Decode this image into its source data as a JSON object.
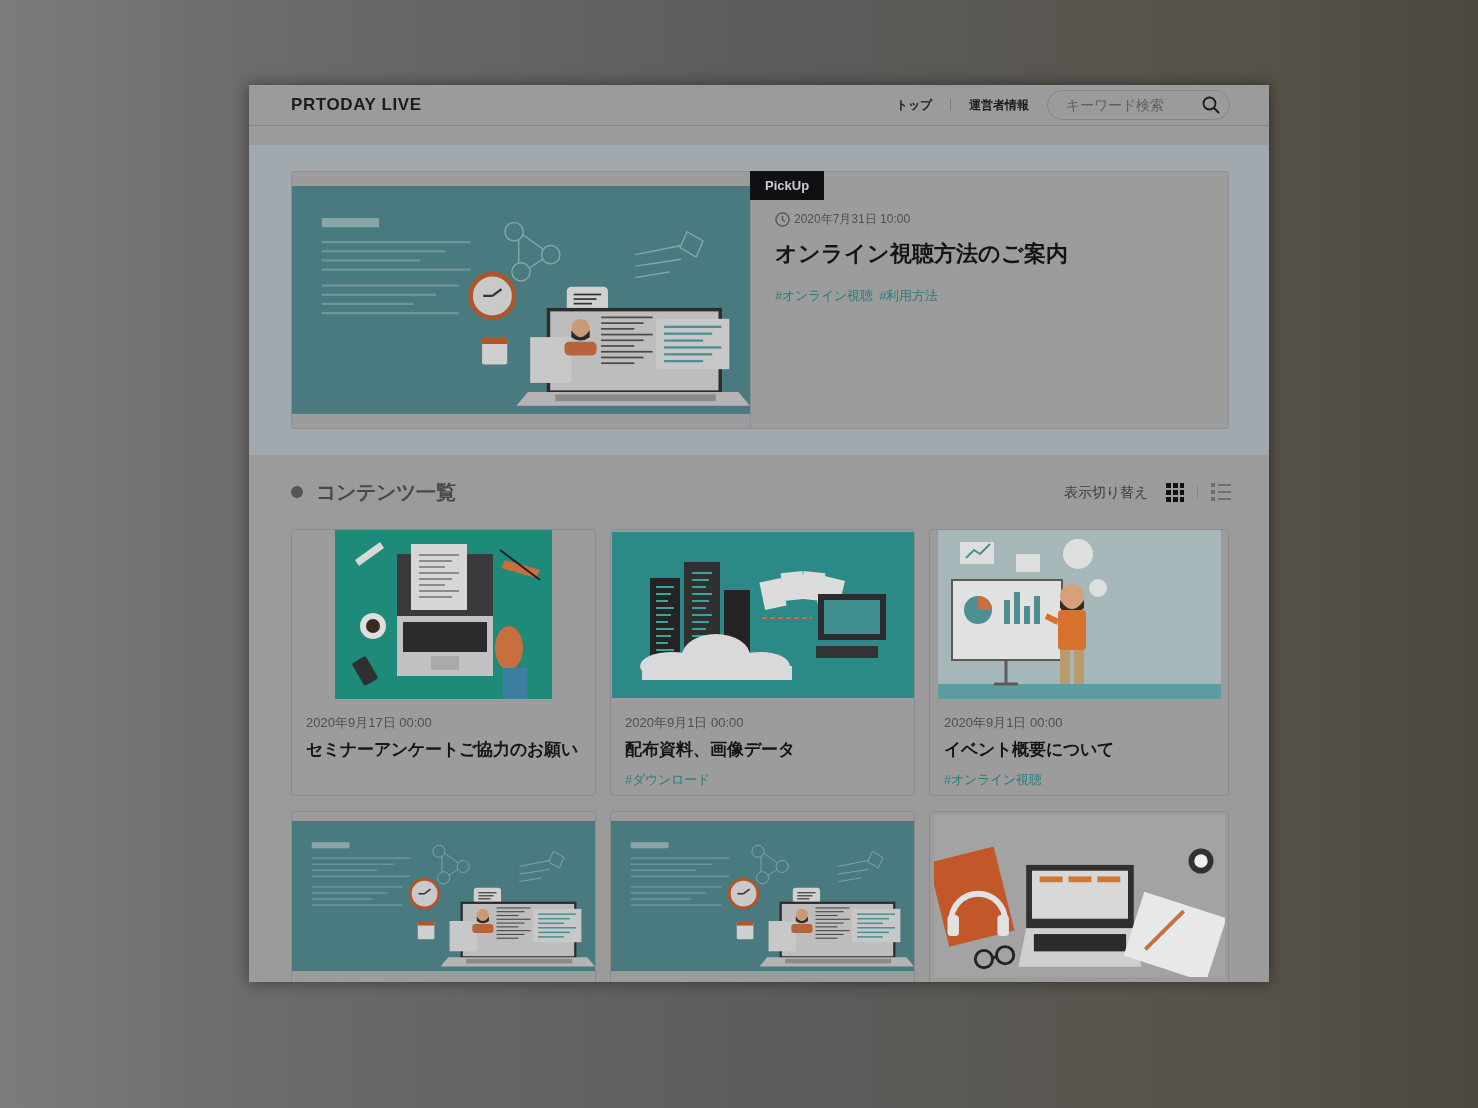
{
  "header": {
    "logo": "PRTODAY LIVE",
    "nav": [
      "トップ",
      "運営者情報"
    ],
    "search": {
      "placeholder": "キーワード検索"
    }
  },
  "pickup": {
    "badge": "PickUp",
    "kind": "webinar",
    "date": "2020年7月31日 10:00",
    "title": "オンライン視聴方法のご案内",
    "tags": [
      "#オンライン視聴",
      "#利用方法"
    ]
  },
  "contents": {
    "heading": "コンテンツ一覧",
    "view_toggle": {
      "label": "表示切り替え",
      "options": [
        {
          "kind": "grid",
          "selected": true
        },
        {
          "kind": "list",
          "selected": false
        }
      ]
    },
    "cards": [
      {
        "kind": "laptop",
        "date": "2020年9月17日 00:00",
        "title": "セミナーアンケートご協力のお願い"
      },
      {
        "kind": "servers",
        "date": "2020年9月1日 00:00",
        "title": "配布資料、画像データ",
        "tags": [
          "#ダウンロード"
        ]
      },
      {
        "kind": "presenter",
        "date": "2020年9月1日 00:00",
        "title": "イベント概要について",
        "tags": [
          "#オンライン視聴"
        ]
      },
      {
        "kind": "webinar"
      },
      {
        "kind": "webinar"
      },
      {
        "kind": "desk"
      }
    ]
  }
}
